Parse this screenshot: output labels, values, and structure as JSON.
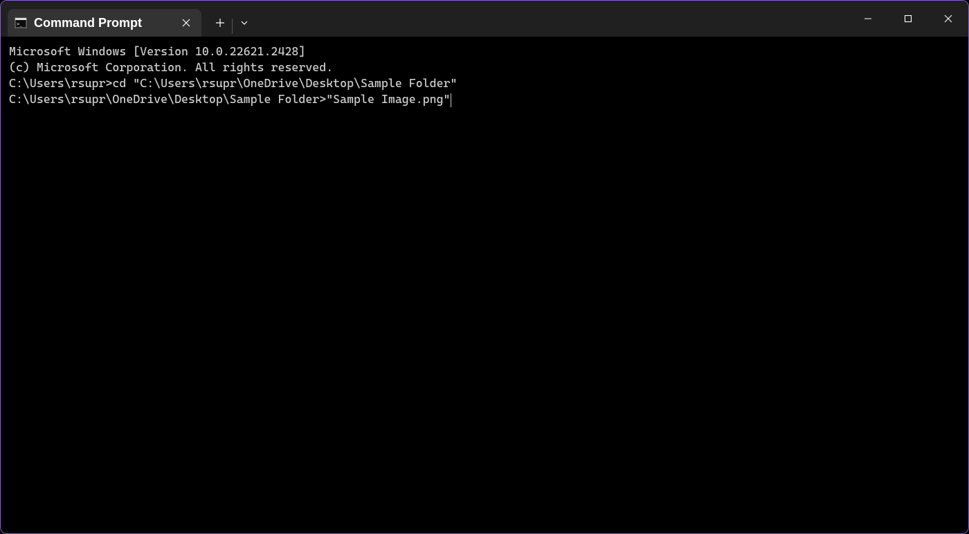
{
  "tab": {
    "title": "Command Prompt"
  },
  "terminal": {
    "lines": [
      "Microsoft Windows [Version 10.0.22621.2428]",
      "(c) Microsoft Corporation. All rights reserved.",
      "",
      "C:\\Users\\rsupr>cd \"C:\\Users\\rsupr\\OneDrive\\Desktop\\Sample Folder\"",
      "",
      "C:\\Users\\rsupr\\OneDrive\\Desktop\\Sample Folder>\"Sample Image.png\""
    ]
  }
}
